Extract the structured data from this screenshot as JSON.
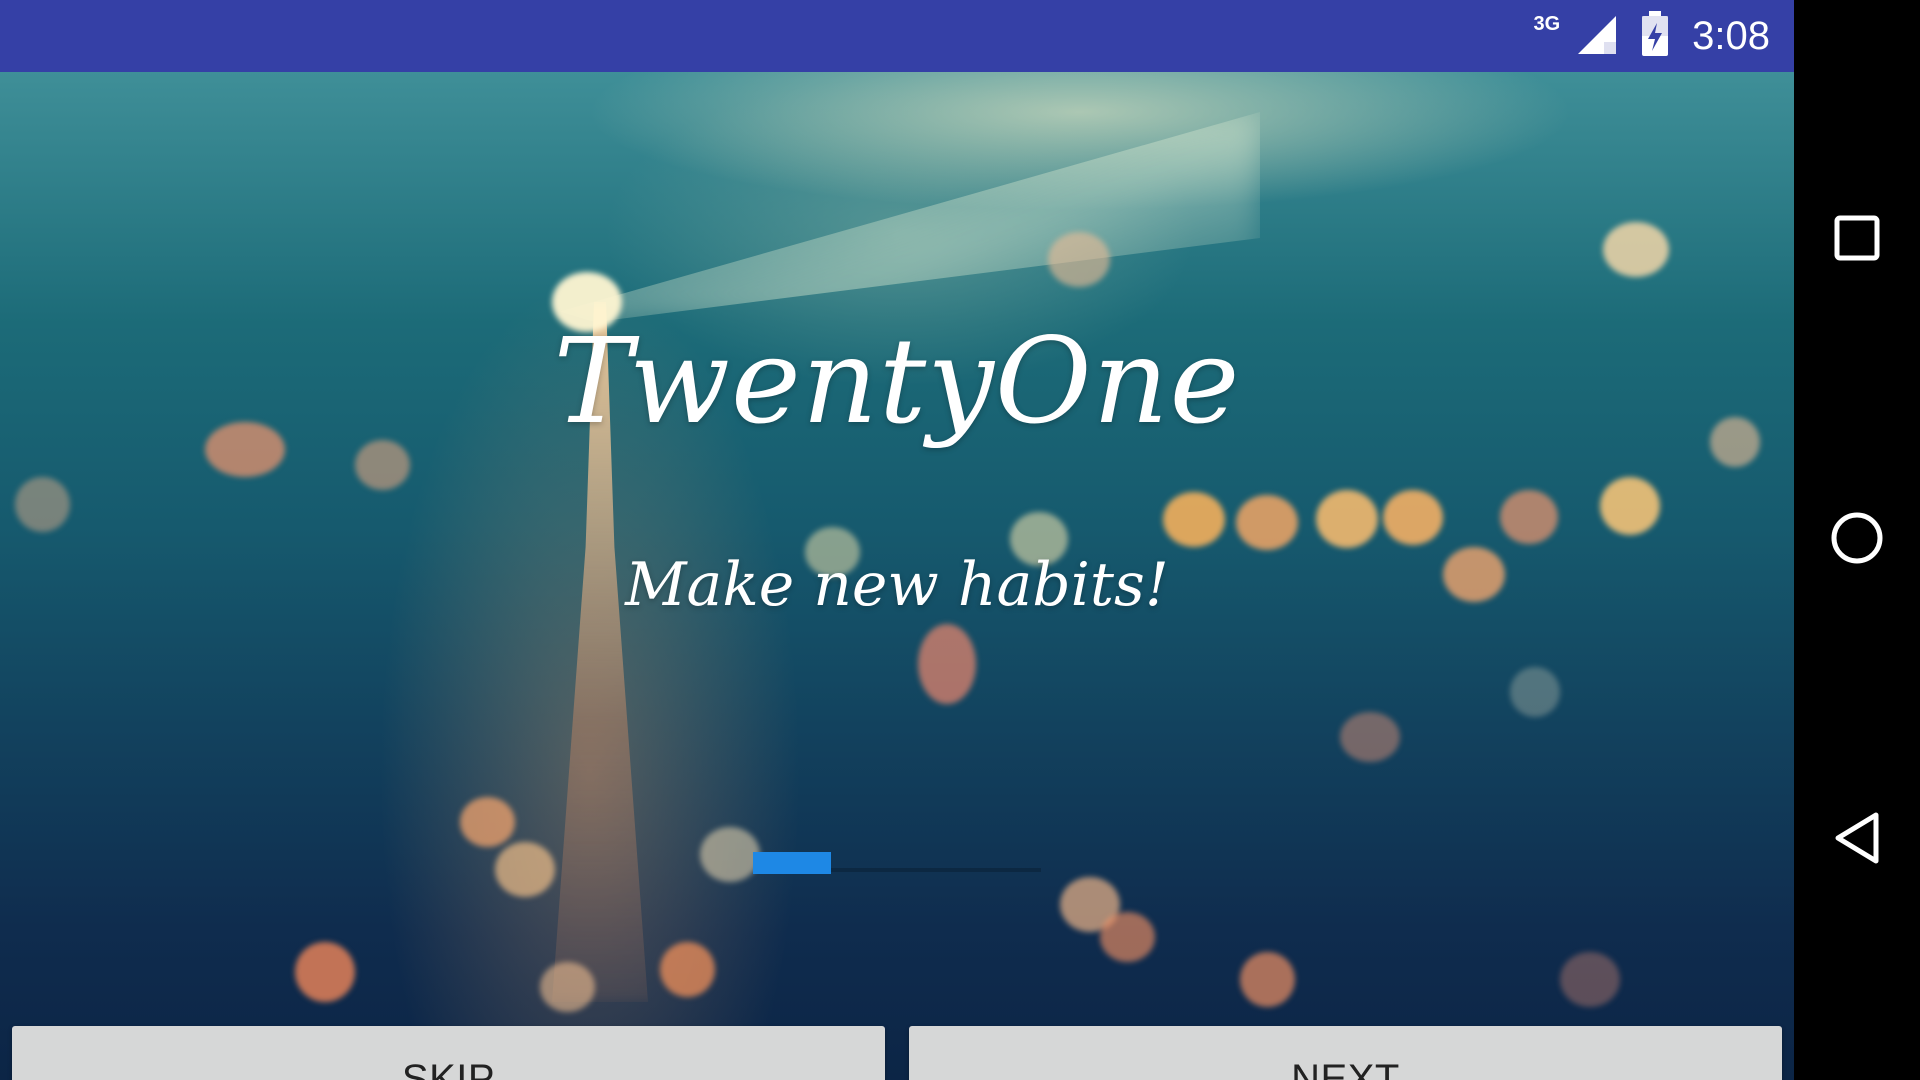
{
  "status_bar": {
    "network_label": "3G",
    "time": "3:08",
    "background_color": "#3540a6",
    "icons": [
      "signal-icon",
      "battery-charging-icon"
    ]
  },
  "onboarding": {
    "title": "TwentyOne",
    "subtitle": "Make new habits!",
    "page_progress": 0.27,
    "indicator_color": "#1e88e5",
    "skip_label": "SKIP",
    "next_label": "NEXT"
  },
  "nav_bar": {
    "icons": [
      "recent-apps-icon",
      "home-icon",
      "back-icon"
    ]
  }
}
